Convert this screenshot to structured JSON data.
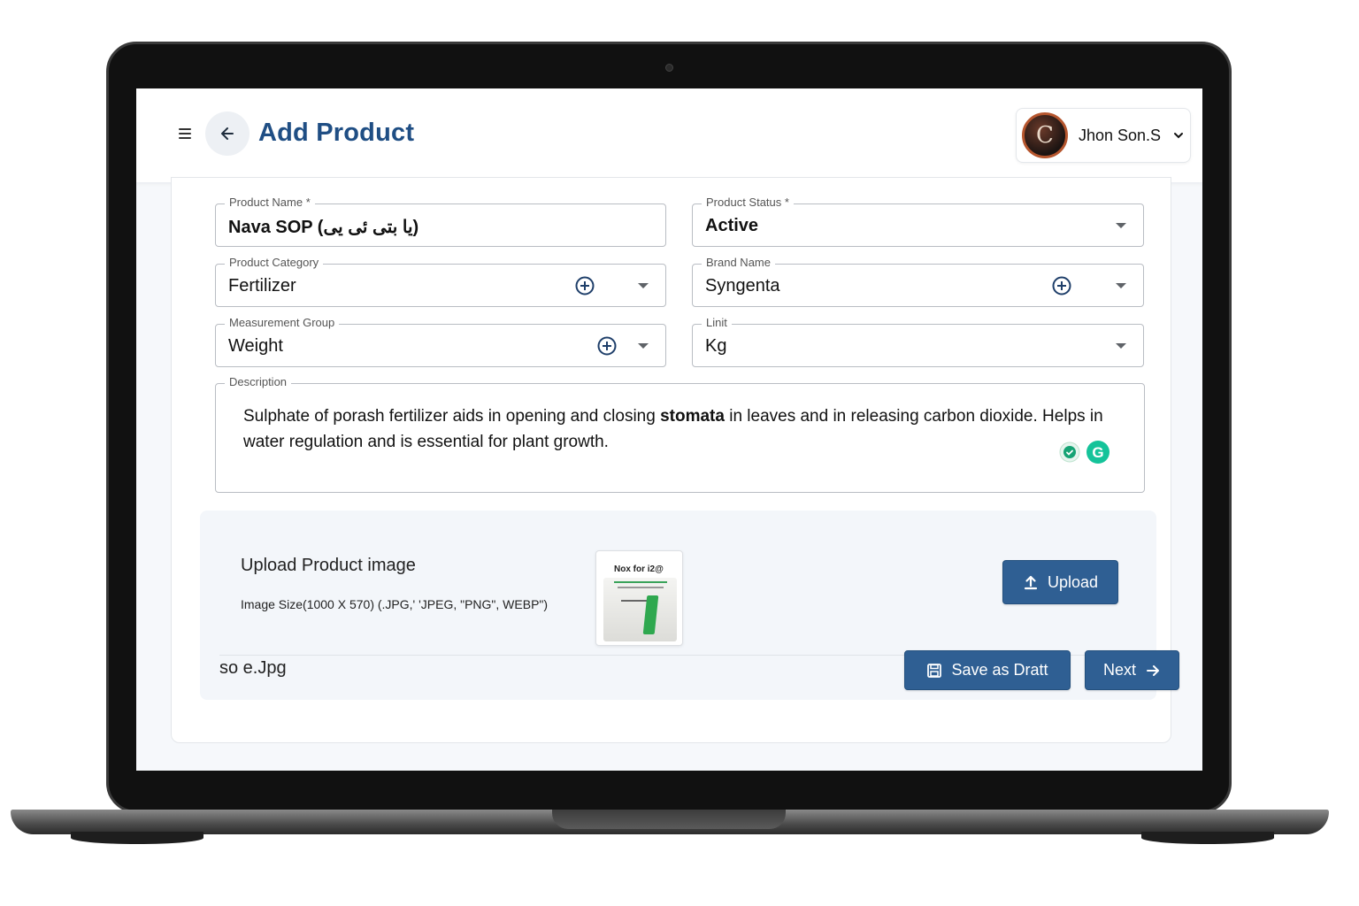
{
  "header": {
    "title": "Add Product",
    "user_name": "Jhon Son.S",
    "avatar_initials": "C"
  },
  "form": {
    "product_name": {
      "label": "Product Name *",
      "value": "Nava SOP (یا بتی ئی یی)"
    },
    "product_status": {
      "label": "Product Status *",
      "value": "Active"
    },
    "product_category": {
      "label": "Product Category",
      "value": "Fertilizer"
    },
    "brand_name": {
      "label": "Brand Name",
      "value": "Syngenta"
    },
    "measurement_group": {
      "label": "Measurement Group",
      "value": "Weight"
    },
    "unit": {
      "label": "Linit",
      "value": "Kg"
    },
    "description": {
      "label": "Description",
      "text_before": "Sulphate of porash fertilizer aids in opening and closing ",
      "text_bold": "stomata",
      "text_after": " in leaves and in releasing carbon dioxide. Helps in water regulation and is essential for plant growth."
    }
  },
  "upload": {
    "title": "Upload Product image",
    "hint": "Image Size(1000 X 570)  (.JPG,' 'JPEG, \"PNG\", WEBP\")",
    "thumbnail_caption": "Nox for i2@",
    "upload_label": "Upload",
    "file_name": "so e.Jpg"
  },
  "actions": {
    "save_draft_label": "Save as Dratt",
    "next_label": "Next"
  },
  "colors": {
    "accent": "#2f5f93",
    "title": "#1f4e84",
    "thumbnail_green": "#2fa84f"
  },
  "icons": [
    "menu-icon",
    "arrow-left-icon",
    "chevron-down-icon",
    "plus-circle-icon",
    "caret-down-icon",
    "upload-icon",
    "save-icon",
    "arrow-right-icon",
    "grammarly-icon"
  ]
}
